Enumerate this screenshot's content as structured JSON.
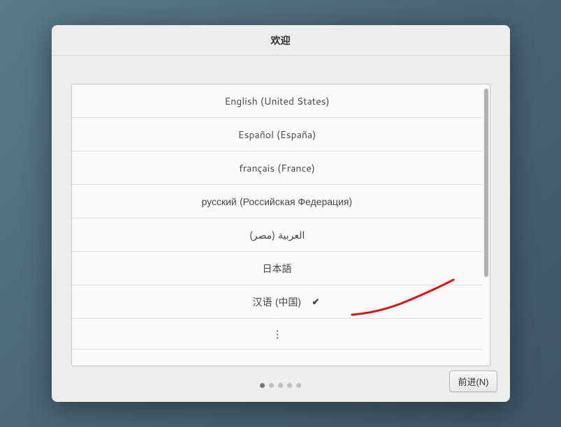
{
  "title": "欢迎",
  "languages": [
    {
      "label": "English (United States)",
      "selected": false
    },
    {
      "label": "Español (España)",
      "selected": false
    },
    {
      "label": "français (France)",
      "selected": false
    },
    {
      "label": "русский (Российская Федерация)",
      "selected": false
    },
    {
      "label": "(العربية (مصر",
      "selected": false
    },
    {
      "label": "日本語",
      "selected": false
    },
    {
      "label": "汉语 (中国)",
      "selected": true
    }
  ],
  "more_icon": "⋮",
  "next_button": "前进(N)",
  "pager": {
    "total": 5,
    "active": 0
  }
}
